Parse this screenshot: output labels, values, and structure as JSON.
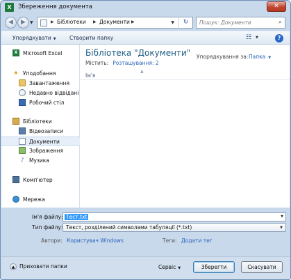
{
  "window": {
    "title": "Збереження документа",
    "app_icon": "X",
    "close_label": "✕"
  },
  "address": {
    "path": [
      "Бібліотеки",
      "Документи"
    ],
    "search_placeholder": "Пошук: Документи"
  },
  "toolbar": {
    "organize_label": "Упорядкувати",
    "new_folder_label": "Створити папку"
  },
  "nav": {
    "items": [
      {
        "label": "Microsoft Excel",
        "icon": "X"
      },
      {
        "label": "Уподобання",
        "icon": "★"
      },
      {
        "label": "Завантаження"
      },
      {
        "label": "Недавно відвідані"
      },
      {
        "label": "Робочий стіл"
      },
      {
        "label": "Бібліотеки"
      },
      {
        "label": "Відеозаписи"
      },
      {
        "label": "Документи"
      },
      {
        "label": "Зображення"
      },
      {
        "label": "Музика",
        "icon": "♪"
      },
      {
        "label": "Комп'ютер"
      },
      {
        "label": "Мережа"
      }
    ]
  },
  "main": {
    "title": "Бібліотека \"Документи\"",
    "includes_label": "Містить:",
    "includes_link": "Розташування: 2",
    "sort_label": "Упорядкування за:",
    "sort_value": "Папка",
    "column_name": "Ім'я"
  },
  "form": {
    "filename_label": "Ім'я файлу:",
    "filename_value": "Тест.txt",
    "filetype_label": "Тип файлу:",
    "filetype_value": "Текст, розділений символами табуляції (*.txt)",
    "authors_label": "Автори:",
    "authors_value": "Користувач Windows",
    "tags_label": "Теги:",
    "tags_value": "Додати тег"
  },
  "bottom": {
    "hide_folders_label": "Приховати папки",
    "service_label": "Сервіс",
    "save_label": "Зберегти",
    "cancel_label": "Скасувати"
  }
}
